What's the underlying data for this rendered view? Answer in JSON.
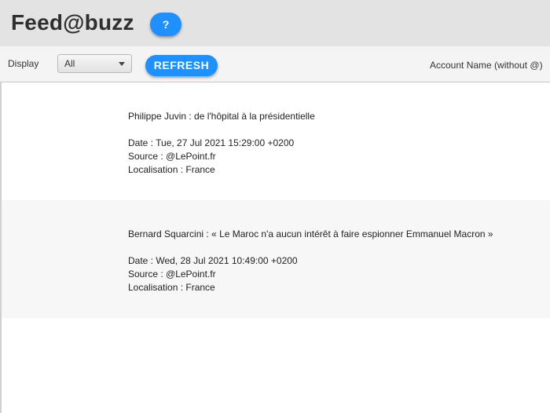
{
  "header": {
    "title": "Feed@buzz",
    "help_label": "?"
  },
  "toolbar": {
    "display_label": "Display",
    "display_select": {
      "selected": "All"
    },
    "refresh_label": "REFRESH",
    "account_placeholder": "Account Name (without @)"
  },
  "feed": {
    "items": [
      {
        "title": "Philippe Juvin : de l'hôpital à la présidentielle",
        "date": "Date : Tue, 27 Jul 2021 15:29:00 +0200",
        "source": "Source : @LePoint.fr",
        "location": "Localisation : France"
      },
      {
        "title": "Bernard Squarcini : « Le Maroc n'a aucun intérêt à faire espionner Emmanuel Macron »",
        "date": "Date : Wed, 28 Jul 2021 10:49:00 +0200",
        "source": "Source : @LePoint.fr",
        "location": "Localisation : France"
      }
    ]
  },
  "colors": {
    "accent": "#1e90ff",
    "header_bg": "#e3e3e3",
    "toolbar_bg": "#f4f4f4",
    "row_alt_bg": "#f7f7f7"
  }
}
